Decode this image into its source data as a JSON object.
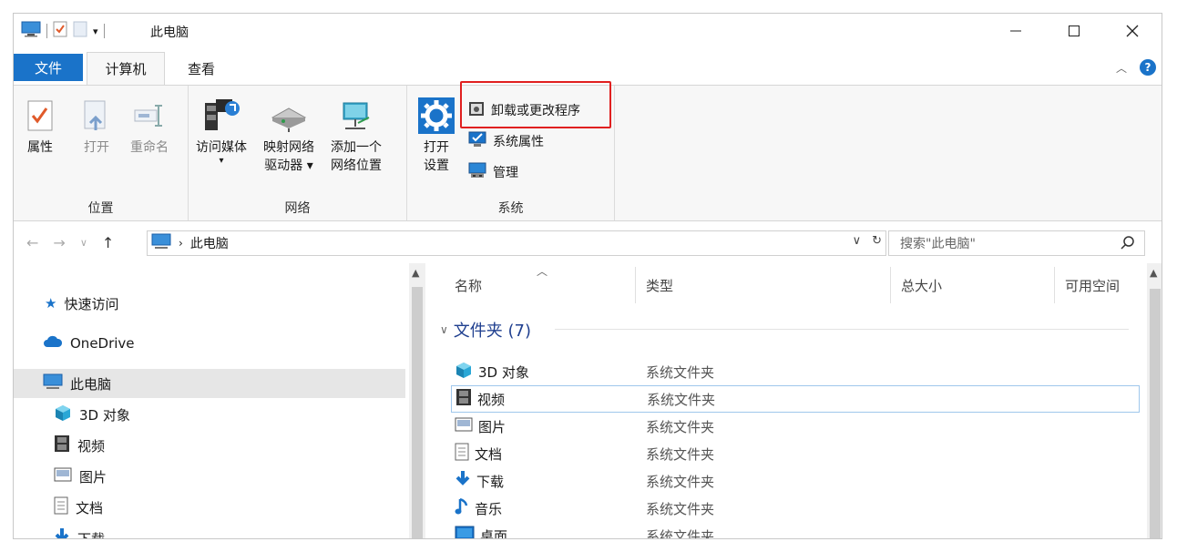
{
  "window": {
    "title": "此电脑"
  },
  "tabs": {
    "file": "文件",
    "computer": "计算机",
    "view": "查看"
  },
  "ribbon": {
    "location": {
      "label": "位置",
      "properties": "属性",
      "open": "打开",
      "rename": "重命名"
    },
    "network": {
      "label": "网络",
      "media_line1": "访问媒体",
      "map_line1": "映射网络",
      "map_line2": "驱动器 ▾",
      "add_line1": "添加一个",
      "add_line2": "网络位置"
    },
    "system": {
      "label": "系统",
      "open_line1": "打开",
      "open_line2": "设置",
      "uninstall": "卸载或更改程序",
      "sys_props": "系统属性",
      "manage": "管理"
    }
  },
  "address": {
    "crumb": "此电脑",
    "search_placeholder": "搜索\"此电脑\""
  },
  "nav": {
    "quick_access": "快速访问",
    "onedrive": "OneDrive",
    "this_pc": "此电脑",
    "items": [
      "3D 对象",
      "视频",
      "图片",
      "文档",
      "下载"
    ]
  },
  "columns": {
    "name": "名称",
    "type": "类型",
    "total": "总大小",
    "free": "可用空间"
  },
  "folders": {
    "group_title": "文件夹 (7)",
    "rows": [
      {
        "name": "3D 对象",
        "type": "系统文件夹"
      },
      {
        "name": "视频",
        "type": "系统文件夹"
      },
      {
        "name": "图片",
        "type": "系统文件夹"
      },
      {
        "name": "文档",
        "type": "系统文件夹"
      },
      {
        "name": "下载",
        "type": "系统文件夹"
      },
      {
        "name": "音乐",
        "type": "系统文件夹"
      },
      {
        "name": "桌面",
        "type": "系统文件夹"
      }
    ]
  },
  "colors": {
    "accent": "#1a73c9",
    "highlight_box": "#e02020",
    "group_title": "#1f3f8f"
  }
}
